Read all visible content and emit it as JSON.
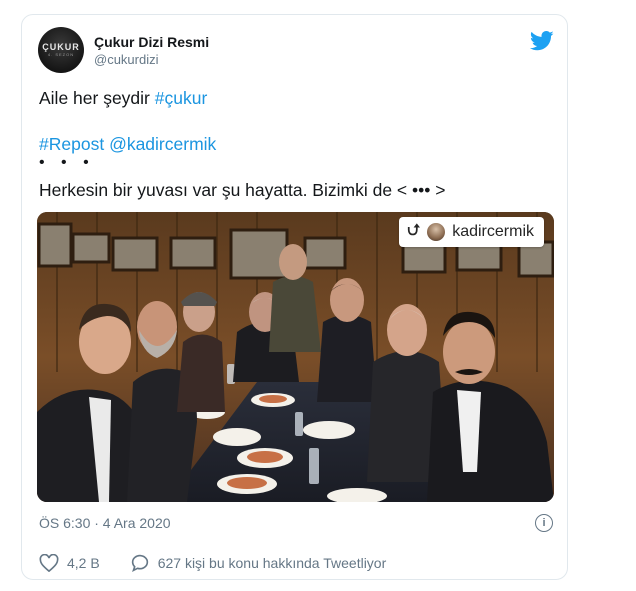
{
  "tweet": {
    "author_name": "Çukur Dizi Resmi",
    "author_handle": "@cukurdizi",
    "avatar_text": "ÇUKUR",
    "avatar_subtext": "4. SEZON",
    "line1_text": "Aile her şeydir ",
    "line1_hashtag": "#çukur",
    "repost_hashtag": "#Repost",
    "repost_mention": "@kadircermik",
    "dots": "• • •",
    "line4_text": "Herkesin bir yuvası var şu hayatta. Bizimki de < ••• >",
    "photo_overlay": {
      "icon": "repost-icon",
      "username": "kadircermik"
    },
    "timestamp": "ÖS 6:30 · 4 Ara 2020",
    "likes": "4,2 B",
    "talking": "627 kişi bu konu hakkında Tweetliyor"
  },
  "colors": {
    "link": "#1b95e0",
    "twitter_blue": "#1da1f2",
    "muted": "#657786",
    "border": "#e1e8ed"
  },
  "icons": [
    "twitter-bird-icon",
    "info-icon",
    "heart-icon",
    "speech-bubble-icon",
    "repost-icon"
  ]
}
